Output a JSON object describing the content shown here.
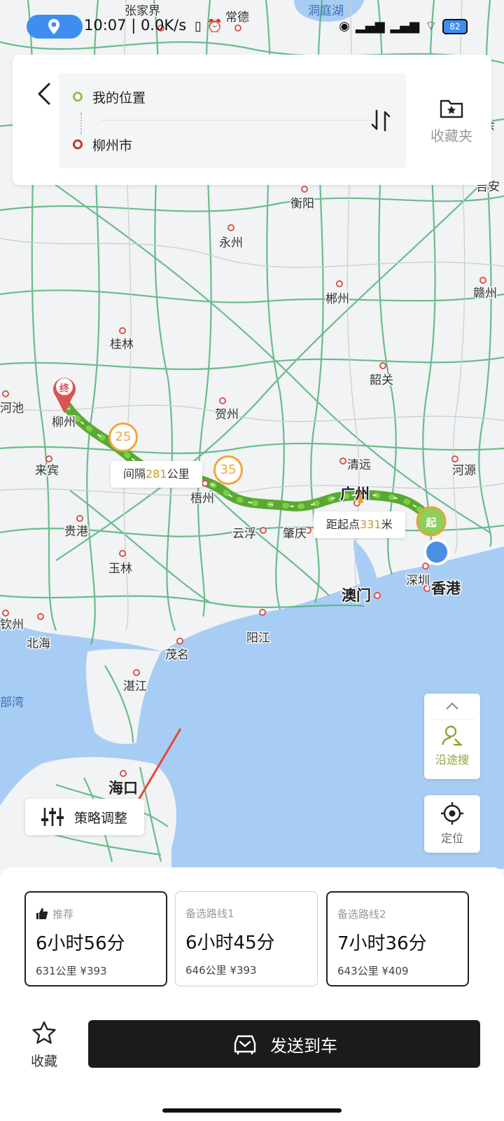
{
  "status_bar": {
    "time_speed": "10:07 | 0.0K/s",
    "battery": "82"
  },
  "route_input": {
    "origin": "我的位置",
    "destination": "柳州市",
    "favorites_label": "收藏夹"
  },
  "map": {
    "cities": [
      "张家界",
      "常德",
      "衡阳",
      "永州",
      "郴州",
      "赣州",
      "桂林",
      "韶关",
      "河池",
      "柳州",
      "贺州",
      "来宾",
      "清远",
      "河源",
      "广州",
      "梧州",
      "贵港",
      "云浮",
      "肇庆",
      "玉林",
      "深圳",
      "香港",
      "澳门",
      "钦州",
      "北海",
      "阳江",
      "茂名",
      "湛江",
      "海口",
      "余",
      "吉安"
    ],
    "water_labels": [
      "洞庭湖",
      "部湾"
    ],
    "end_marker": "终",
    "start_marker": "起",
    "route_color": "#6fbf3c",
    "label_interval_prefix": "间隔",
    "label_interval_value": "281",
    "label_interval_suffix": "公里",
    "label_distance_prefix": "距起点",
    "label_distance_value": "331",
    "label_distance_suffix": "米",
    "speed_limits": [
      "25",
      "35"
    ]
  },
  "side_buttons": {
    "along_search": "沿途搜",
    "locate": "定位"
  },
  "strategy_label": "策略调整",
  "routes": [
    {
      "tag": "推荐",
      "duration": "6小时56分",
      "meta": "631公里 ¥393"
    },
    {
      "tag": "备选路线1",
      "duration": "6小时45分",
      "meta": "646公里 ¥393"
    },
    {
      "tag": "备选路线2",
      "duration": "7小时36分",
      "meta": "643公里 ¥409"
    }
  ],
  "bottom": {
    "collect_label": "收藏",
    "send_label": "发送到车"
  },
  "icons": {
    "status_location": "location-pin-icon",
    "back": "chevron-left-icon",
    "swap": "swap-arrows-icon",
    "favorites": "folder-star-icon",
    "expand": "chevron-up-icon",
    "along_search": "person-search-icon",
    "locate": "crosshair-icon",
    "strategy": "sliders-icon",
    "recommended": "thumbs-up-icon",
    "collect": "star-icon",
    "car": "car-icon"
  },
  "colors": {
    "accent": "#3d8ef0",
    "send_button": "#1b1b1b",
    "along_search": "#8aa536"
  }
}
